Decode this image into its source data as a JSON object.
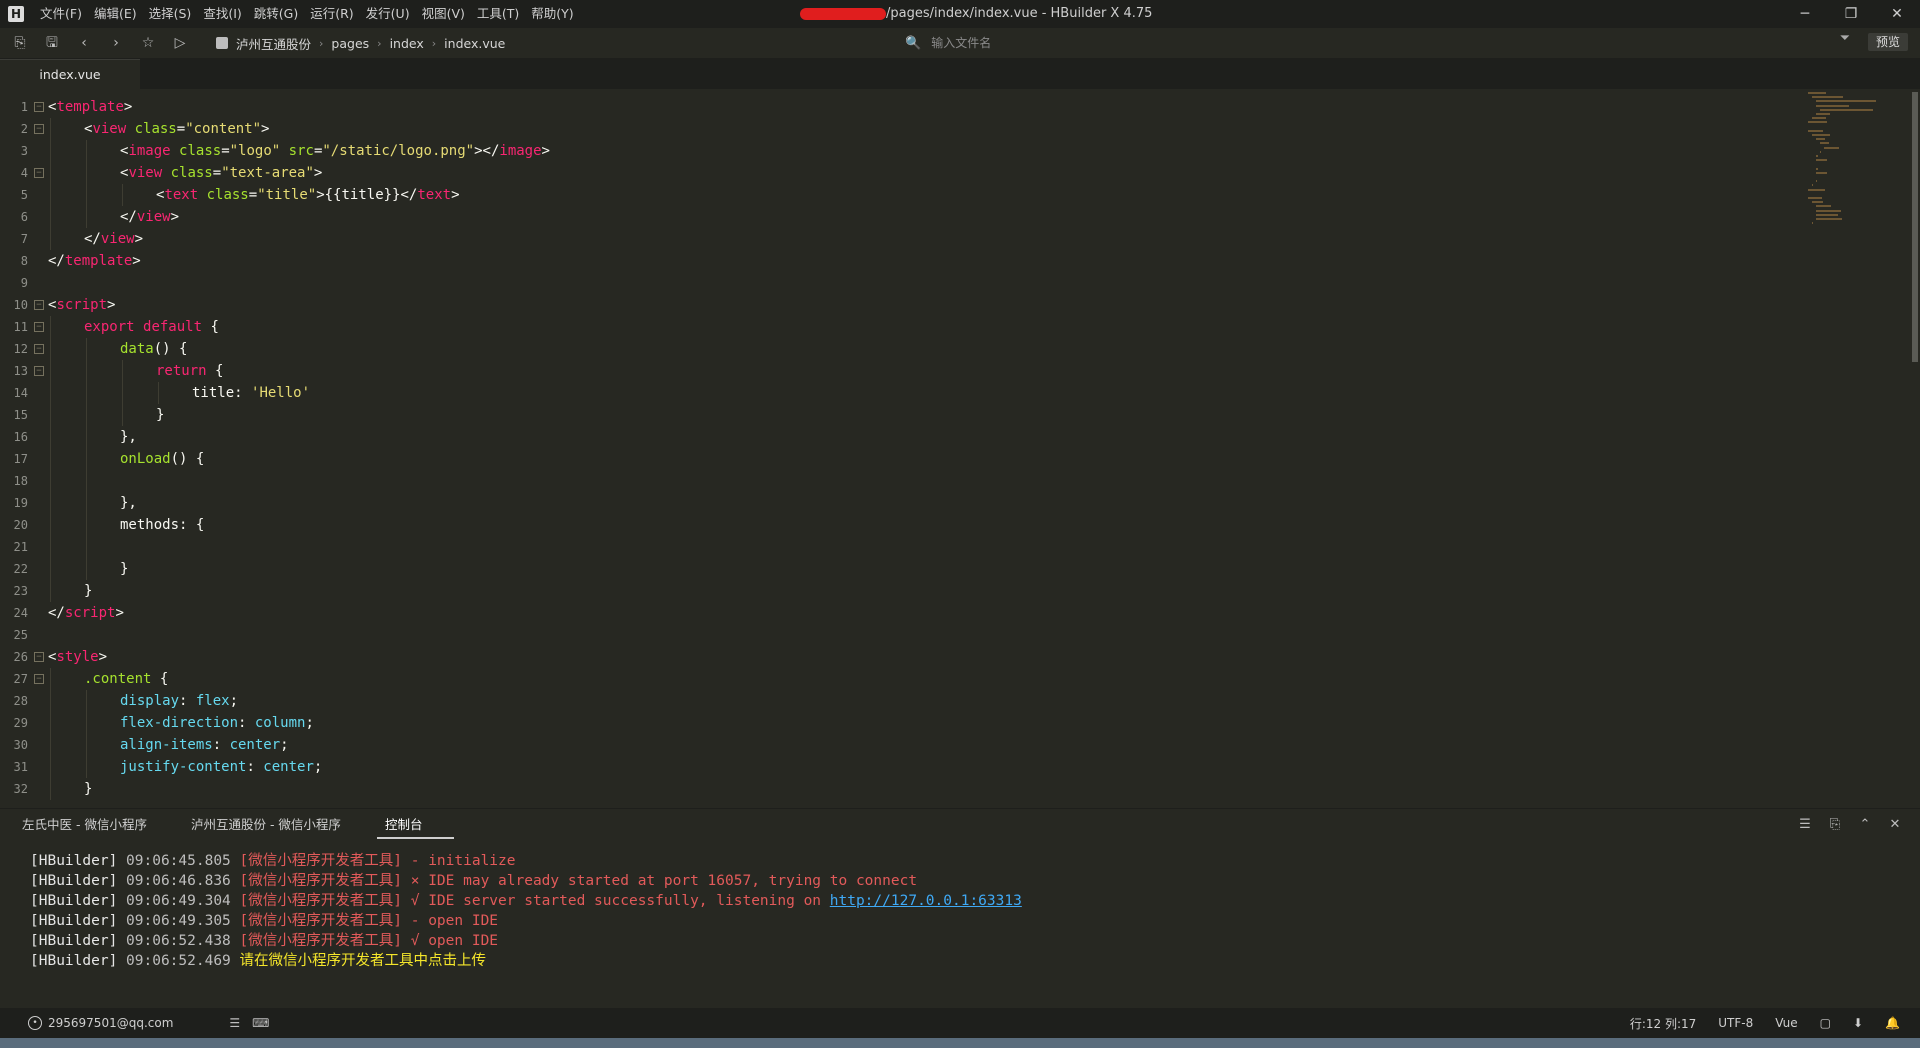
{
  "titlebar": {
    "menu": [
      "文件(F)",
      "编辑(E)",
      "选择(S)",
      "查找(I)",
      "跳转(G)",
      "运行(R)",
      "发行(U)",
      "视图(V)",
      "工具(T)",
      "帮助(Y)"
    ],
    "window_title": "/pages/index/index.vue - HBuilder X 4.75",
    "win_minimize": "─",
    "win_restore": "❐",
    "win_close": "✕"
  },
  "toolbar": {
    "breadcrumb": [
      "泸州互通股份",
      "pages",
      "index",
      "index.vue"
    ],
    "search_placeholder": "输入文件名",
    "preview_label": "预览"
  },
  "tab": {
    "label": "index.vue"
  },
  "editor": {
    "lines": [
      {
        "n": "1",
        "fold": true,
        "indent": 0,
        "html": "<span class='t-punc'>&lt;</span><span class='t-tag'>template</span><span class='t-punc'>&gt;</span>"
      },
      {
        "n": "2",
        "fold": true,
        "indent": 1,
        "html": "<span class='t-punc'>&lt;</span><span class='t-tag'>view</span> <span class='t-attr'>class</span>=<span class='t-str'>\"content\"</span><span class='t-punc'>&gt;</span>"
      },
      {
        "n": "3",
        "fold": false,
        "indent": 2,
        "html": "<span class='t-punc'>&lt;</span><span class='t-tag'>image</span> <span class='t-attr'>class</span>=<span class='t-str'>\"logo\"</span> <span class='t-attr'>src</span>=<span class='t-str'>\"/static/logo.png\"</span><span class='t-punc'>&gt;&lt;/</span><span class='t-tag'>image</span><span class='t-punc'>&gt;</span>"
      },
      {
        "n": "4",
        "fold": true,
        "indent": 2,
        "html": "<span class='t-punc'>&lt;</span><span class='t-tag'>view</span> <span class='t-attr'>class</span>=<span class='t-str'>\"text-area\"</span><span class='t-punc'>&gt;</span>"
      },
      {
        "n": "5",
        "fold": false,
        "indent": 3,
        "html": "<span class='t-punc'>&lt;</span><span class='t-tag'>text</span> <span class='t-attr'>class</span>=<span class='t-str'>\"title\"</span><span class='t-punc'>&gt;{{title}}&lt;/</span><span class='t-tag'>text</span><span class='t-punc'>&gt;</span>"
      },
      {
        "n": "6",
        "fold": false,
        "indent": 2,
        "html": "<span class='t-punc'>&lt;/</span><span class='t-tag'>view</span><span class='t-punc'>&gt;</span>"
      },
      {
        "n": "7",
        "fold": false,
        "indent": 1,
        "html": "<span class='t-punc'>&lt;/</span><span class='t-tag'>view</span><span class='t-punc'>&gt;</span>"
      },
      {
        "n": "8",
        "fold": false,
        "indent": 0,
        "html": "<span class='t-punc'>&lt;/</span><span class='t-tag'>template</span><span class='t-punc'>&gt;</span>"
      },
      {
        "n": "9",
        "fold": false,
        "indent": 0,
        "html": ""
      },
      {
        "n": "10",
        "fold": true,
        "indent": 0,
        "html": "<span class='t-punc'>&lt;</span><span class='t-tag'>script</span><span class='t-punc'>&gt;</span>"
      },
      {
        "n": "11",
        "fold": true,
        "indent": 1,
        "html": "<span class='t-kw'>export</span> <span class='t-kw'>default</span> {"
      },
      {
        "n": "12",
        "fold": true,
        "indent": 2,
        "html": "<span class='t-fn'>data</span>() {"
      },
      {
        "n": "13",
        "fold": true,
        "indent": 3,
        "html": "<span class='t-kw'>return</span> {"
      },
      {
        "n": "14",
        "fold": false,
        "indent": 4,
        "html": "title: <span class='t-str'>'Hello'</span>"
      },
      {
        "n": "15",
        "fold": false,
        "indent": 3,
        "html": "}"
      },
      {
        "n": "16",
        "fold": false,
        "indent": 2,
        "html": "},"
      },
      {
        "n": "17",
        "fold": false,
        "indent": 2,
        "html": "<span class='t-fn'>onLoad</span>() {"
      },
      {
        "n": "18",
        "fold": false,
        "indent": 2,
        "html": ""
      },
      {
        "n": "19",
        "fold": false,
        "indent": 2,
        "html": "},"
      },
      {
        "n": "20",
        "fold": false,
        "indent": 2,
        "html": "methods: {"
      },
      {
        "n": "21",
        "fold": false,
        "indent": 2,
        "html": ""
      },
      {
        "n": "22",
        "fold": false,
        "indent": 2,
        "html": "}"
      },
      {
        "n": "23",
        "fold": false,
        "indent": 1,
        "html": "}"
      },
      {
        "n": "24",
        "fold": false,
        "indent": 0,
        "html": "<span class='t-punc'>&lt;/</span><span class='t-tag'>script</span><span class='t-punc'>&gt;</span>"
      },
      {
        "n": "25",
        "fold": false,
        "indent": 0,
        "html": ""
      },
      {
        "n": "26",
        "fold": true,
        "indent": 0,
        "html": "<span class='t-punc'>&lt;</span><span class='t-tag'>style</span><span class='t-punc'>&gt;</span>"
      },
      {
        "n": "27",
        "fold": true,
        "indent": 1,
        "html": "<span class='t-sel'>.content</span> {"
      },
      {
        "n": "28",
        "fold": false,
        "indent": 2,
        "html": "<span class='t-val'>display</span>: <span class='t-val'>flex</span>;"
      },
      {
        "n": "29",
        "fold": false,
        "indent": 2,
        "html": "<span class='t-val'>flex-direction</span>: <span class='t-val'>column</span>;"
      },
      {
        "n": "30",
        "fold": false,
        "indent": 2,
        "html": "<span class='t-val'>align-items</span>: <span class='t-val'>center</span>;"
      },
      {
        "n": "31",
        "fold": false,
        "indent": 2,
        "html": "<span class='t-val'>justify-content</span>: <span class='t-val'>center</span>;"
      },
      {
        "n": "32",
        "fold": false,
        "indent": 1,
        "html": "}"
      }
    ]
  },
  "panel": {
    "tabs": [
      "左氏中医 - 微信小程序",
      "泸州互通股份 - 微信小程序",
      "控制台"
    ],
    "active_tab": 2,
    "console": [
      {
        "prefix": "[HBuilder]",
        "time": "09:06:45.805",
        "src": "[微信小程序开发者工具]",
        "msg": " - initialize",
        "cls": "c-msg-red",
        "link": ""
      },
      {
        "prefix": "[HBuilder]",
        "time": "09:06:46.836",
        "src": "[微信小程序开发者工具]",
        "msg": " × IDE may already started at port 16057, trying to connect",
        "cls": "c-msg-red",
        "link": ""
      },
      {
        "prefix": "[HBuilder]",
        "time": "09:06:49.304",
        "src": "[微信小程序开发者工具]",
        "msg": " √ IDE server started successfully, listening on ",
        "cls": "c-msg-red",
        "link": "http://127.0.0.1:63313"
      },
      {
        "prefix": "[HBuilder]",
        "time": "09:06:49.305",
        "src": "[微信小程序开发者工具]",
        "msg": " - open IDE",
        "cls": "c-msg-red",
        "link": ""
      },
      {
        "prefix": "[HBuilder]",
        "time": "09:06:52.438",
        "src": "[微信小程序开发者工具]",
        "msg": " √ open IDE",
        "cls": "c-msg-red",
        "link": ""
      },
      {
        "prefix": "[HBuilder]",
        "time": "09:06:52.469",
        "src": "请在微信小程序开发者工具中点击上传",
        "msg": "",
        "cls": "c-yellow",
        "link": ""
      }
    ]
  },
  "statusbar": {
    "user": "295697501@qq.com",
    "position": "行:12  列:17",
    "encoding": "UTF-8",
    "language": "Vue"
  }
}
